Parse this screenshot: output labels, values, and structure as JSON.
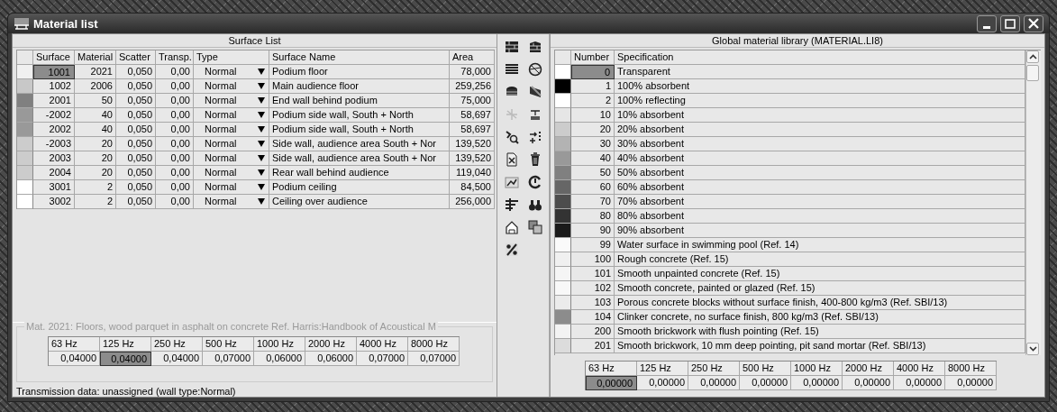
{
  "window": {
    "title": "Material list"
  },
  "surface_list": {
    "title": "Surface List",
    "columns": [
      "Surface",
      "Material",
      "Scatter",
      "Transp.",
      "Type",
      "Surface Name",
      "Area"
    ],
    "rows": [
      {
        "color": "#f0f0f0",
        "surface": "1001",
        "material": "2021",
        "scatter": "0,050",
        "transp": "0,00",
        "type": "Normal",
        "name": "Podium floor",
        "area": "78,000",
        "selected": true
      },
      {
        "color": "#c8c8c8",
        "surface": "1002",
        "material": "2006",
        "scatter": "0,050",
        "transp": "0,00",
        "type": "Normal",
        "name": "Main audience floor",
        "area": "259,256",
        "selected": false
      },
      {
        "color": "#808080",
        "surface": "2001",
        "material": "50",
        "scatter": "0,050",
        "transp": "0,00",
        "type": "Normal",
        "name": "End wall behind podium",
        "area": "75,000",
        "selected": false
      },
      {
        "color": "#999999",
        "surface": "-2002",
        "material": "40",
        "scatter": "0,050",
        "transp": "0,00",
        "type": "Normal",
        "name": "Podium side wall, South + North",
        "area": "58,697",
        "selected": false
      },
      {
        "color": "#999999",
        "surface": "2002",
        "material": "40",
        "scatter": "0,050",
        "transp": "0,00",
        "type": "Normal",
        "name": "Podium side wall, South + North",
        "area": "58,697",
        "selected": false
      },
      {
        "color": "#cccccc",
        "surface": "-2003",
        "material": "20",
        "scatter": "0,050",
        "transp": "0,00",
        "type": "Normal",
        "name": "Side wall, audience area South + Nor",
        "area": "139,520",
        "selected": false
      },
      {
        "color": "#cccccc",
        "surface": "2003",
        "material": "20",
        "scatter": "0,050",
        "transp": "0,00",
        "type": "Normal",
        "name": "Side wall, audience area South + Nor",
        "area": "139,520",
        "selected": false
      },
      {
        "color": "#cccccc",
        "surface": "2004",
        "material": "20",
        "scatter": "0,050",
        "transp": "0,00",
        "type": "Normal",
        "name": "Rear wall behind audience",
        "area": "119,040",
        "selected": false
      },
      {
        "color": "#ffffff",
        "surface": "3001",
        "material": "2",
        "scatter": "0,050",
        "transp": "0,00",
        "type": "Normal",
        "name": "Podium ceiling",
        "area": "84,500",
        "selected": false
      },
      {
        "color": "#ffffff",
        "surface": "3002",
        "material": "2",
        "scatter": "0,050",
        "transp": "0,00",
        "type": "Normal",
        "name": "Ceiling over audience",
        "area": "256,000",
        "selected": false
      }
    ]
  },
  "material_info": "Mat. 2021: Floors, wood parquet in asphalt on concrete Ref. Harris:Handbook of Acoustical M",
  "absorption": {
    "bands": [
      "63 Hz",
      "125 Hz",
      "250 Hz",
      "500 Hz",
      "1000 Hz",
      "2000 Hz",
      "4000 Hz",
      "8000 Hz"
    ],
    "values": [
      {
        "value": "0,04000",
        "selected": false
      },
      {
        "value": "0,04000",
        "selected": true
      },
      {
        "value": "0,04000",
        "selected": false
      },
      {
        "value": "0,07000",
        "selected": false
      },
      {
        "value": "0,06000",
        "selected": false
      },
      {
        "value": "0,06000",
        "selected": false
      },
      {
        "value": "0,07000",
        "selected": false
      },
      {
        "value": "0,07000",
        "selected": false
      }
    ]
  },
  "transmission": "Transmission data: unassigned (wall type:Normal)",
  "library": {
    "title": "Global material library (MATERIAL.LI8)",
    "columns": [
      "Number",
      "Specification"
    ],
    "rows": [
      {
        "color": "#ffffff",
        "number": "0",
        "spec": "Transparent",
        "selected": true
      },
      {
        "color": "#000000",
        "number": "1",
        "spec": "100% absorbent",
        "selected": false
      },
      {
        "color": "#ffffff",
        "number": "2",
        "spec": "100% reflecting",
        "selected": false
      },
      {
        "color": "#e6e6e6",
        "number": "10",
        "spec": "10% absorbent",
        "selected": false
      },
      {
        "color": "#cccccc",
        "number": "20",
        "spec": "20% absorbent",
        "selected": false
      },
      {
        "color": "#b3b3b3",
        "number": "30",
        "spec": "30% absorbent",
        "selected": false
      },
      {
        "color": "#999999",
        "number": "40",
        "spec": "40% absorbent",
        "selected": false
      },
      {
        "color": "#808080",
        "number": "50",
        "spec": "50% absorbent",
        "selected": false
      },
      {
        "color": "#666666",
        "number": "60",
        "spec": "60% absorbent",
        "selected": false
      },
      {
        "color": "#4d4d4d",
        "number": "70",
        "spec": "70% absorbent",
        "selected": false
      },
      {
        "color": "#333333",
        "number": "80",
        "spec": "80% absorbent",
        "selected": false
      },
      {
        "color": "#1a1a1a",
        "number": "90",
        "spec": "90% absorbent",
        "selected": false
      },
      {
        "color": "#fafafa",
        "number": "99",
        "spec": "Water surface in swimming pool (Ref. 14)",
        "selected": false
      },
      {
        "color": "#f0f0f0",
        "number": "100",
        "spec": "Rough concrete (Ref. 15)",
        "selected": false
      },
      {
        "color": "#f5f5f5",
        "number": "101",
        "spec": "Smooth unpainted concrete (Ref. 15)",
        "selected": false
      },
      {
        "color": "#f8f8f8",
        "number": "102",
        "spec": "Smooth concrete, painted or glazed (Ref. 15)",
        "selected": false
      },
      {
        "color": "#ebebeb",
        "number": "103",
        "spec": "Porous concrete blocks without surface finish, 400-800 kg/m3 (Ref. SBI/13)",
        "selected": false
      },
      {
        "color": "#8c8c8c",
        "number": "104",
        "spec": "Clinker concrete, no surface finish, 800 kg/m3 (Ref. SBI/13)",
        "selected": false
      },
      {
        "color": "#f3f3f3",
        "number": "200",
        "spec": "Smooth brickwork with flush pointing (Ref. 15)",
        "selected": false
      },
      {
        "color": "#dcdcdc",
        "number": "201",
        "spec": "Smooth brickwork, 10 mm deep pointing, pit sand mortar (Ref. SBI/13)",
        "selected": false
      }
    ]
  },
  "library_absorption": {
    "bands": [
      "63 Hz",
      "125 Hz",
      "250 Hz",
      "500 Hz",
      "1000 Hz",
      "2000 Hz",
      "4000 Hz",
      "8000 Hz"
    ],
    "values": [
      {
        "value": "0,00000",
        "selected": true
      },
      {
        "value": "0,00000",
        "selected": false
      },
      {
        "value": "0,00000",
        "selected": false
      },
      {
        "value": "0,00000",
        "selected": false
      },
      {
        "value": "0,00000",
        "selected": false
      },
      {
        "value": "0,00000",
        "selected": false
      },
      {
        "value": "0,00000",
        "selected": false
      },
      {
        "value": "0,00000",
        "selected": false
      }
    ]
  }
}
